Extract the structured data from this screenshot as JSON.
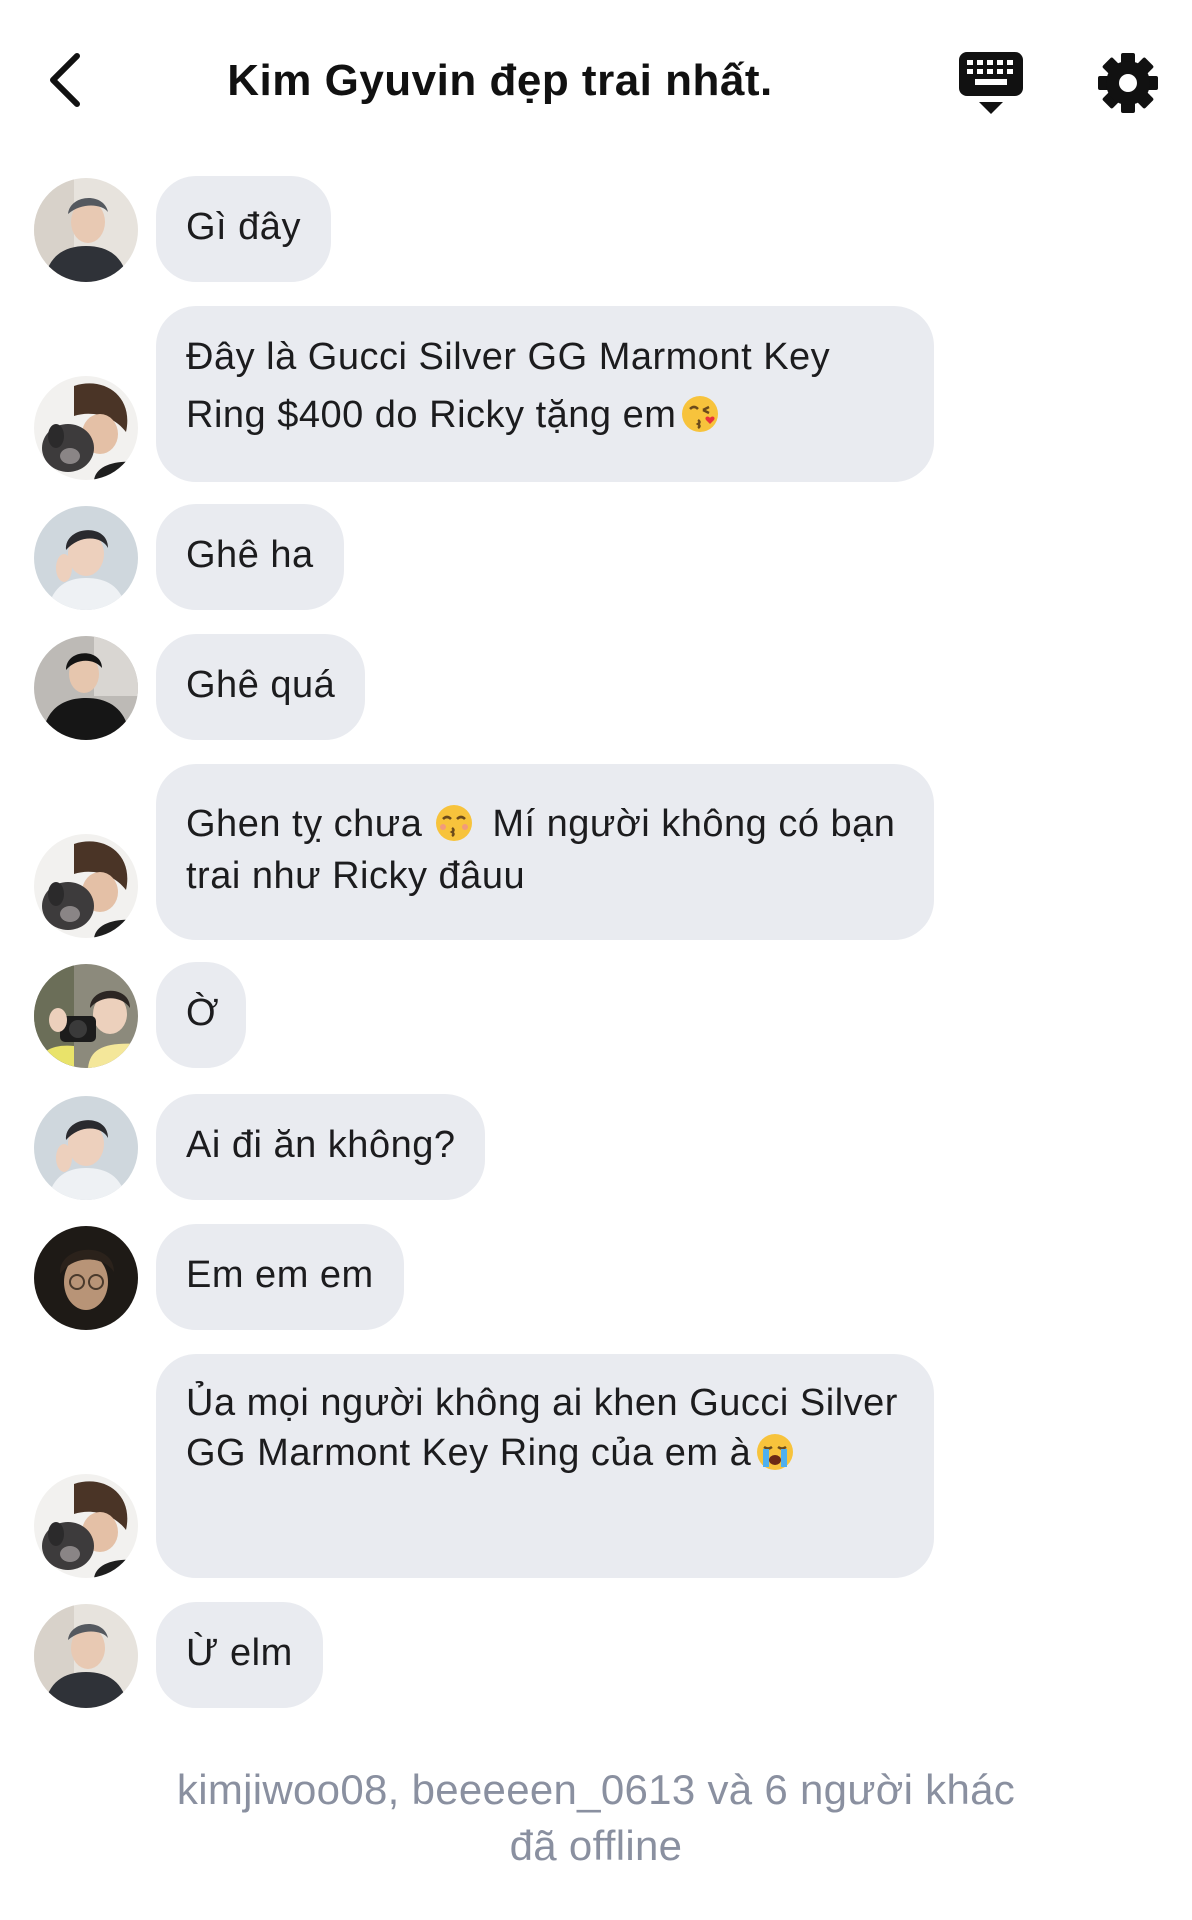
{
  "header": {
    "title": "Kim Gyuvin đẹp trai nhất.",
    "back_icon": "chevron-left-icon",
    "keyboard_icon": "keyboard-icon",
    "settings_icon": "gear-icon"
  },
  "messages": [
    {
      "avatar": "avatar-man-gray-hair",
      "text": "Gì đây"
    },
    {
      "avatar": "avatar-man-with-dog",
      "text": "Đây là Gucci Silver GG Marmont Key Ring $400 do Ricky tặng em",
      "emoji": "kissing-face-with-heart-emoji"
    },
    {
      "avatar": "avatar-man-light-shirt",
      "text": "Ghê ha"
    },
    {
      "avatar": "avatar-man-black-sweater",
      "text": "Ghê quá"
    },
    {
      "avatar": "avatar-man-with-dog",
      "text_a": "Ghen tỵ chưa",
      "text_b": "Mí người không có bạn trai như Ricky đâuu",
      "emoji": "kissing-smiling-eyes-emoji"
    },
    {
      "avatar": "avatar-man-with-camera",
      "text": "Ờ"
    },
    {
      "avatar": "avatar-man-light-shirt",
      "text": "Ai đi ăn không?"
    },
    {
      "avatar": "avatar-man-glasses-dark",
      "text": "Em em em"
    },
    {
      "avatar": "avatar-man-with-dog",
      "text": "Ủa mọi người không ai khen Gucci Silver GG Marmont Key Ring của em à",
      "emoji": "loudly-crying-face-emoji"
    },
    {
      "avatar": "avatar-man-gray-hair",
      "text": "Ừ elm"
    }
  ],
  "footer": {
    "line1": "kimjiwoo08, beeeeen_0613 và 6 người khác",
    "line2": "đã offline"
  },
  "colors": {
    "bubble": "#e9ebf0",
    "footer_text": "#8a90a0",
    "text": "#1c1c1e"
  }
}
